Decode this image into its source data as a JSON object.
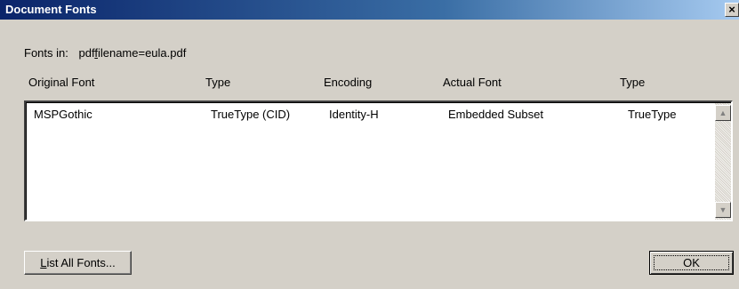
{
  "window": {
    "title": "Document Fonts",
    "close_label": "×"
  },
  "fonts_in": {
    "label": "Fonts in:",
    "filename_pre": "pdf",
    "filename_u": "f",
    "filename_post": "ilename=eula.pdf"
  },
  "columns": [
    "Original Font",
    "Type",
    "Encoding",
    "Actual Font",
    "Type"
  ],
  "rows": [
    {
      "original_font": "MSPGothic",
      "type": "TrueType (CID)",
      "encoding": "Identity-H",
      "actual_font": "Embedded Subset",
      "actual_type": "TrueType"
    }
  ],
  "scrollbar": {
    "up_icon": "▲",
    "down_icon": "▼"
  },
  "buttons": {
    "list_all_u": "L",
    "list_all_rest": "ist All Fonts...",
    "ok": "OK"
  }
}
